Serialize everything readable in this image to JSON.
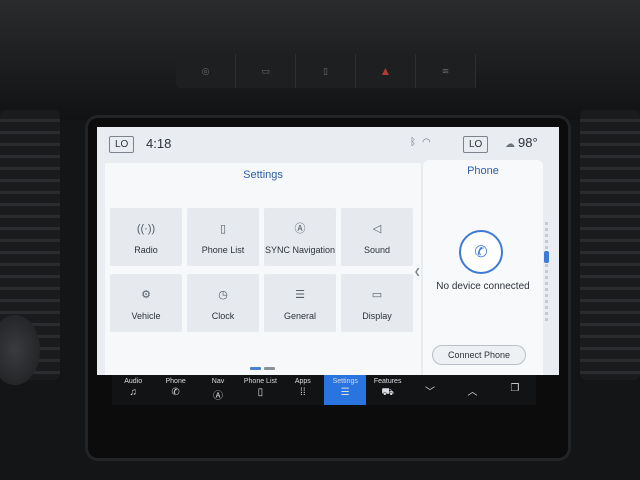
{
  "status": {
    "left_badge": "LO",
    "time": "4:18",
    "right_badge": "LO",
    "temperature": "98°"
  },
  "settings": {
    "title": "Settings",
    "tiles": [
      {
        "label": "Radio",
        "icon": "radio-icon",
        "glyph": "((·))"
      },
      {
        "label": "Phone List",
        "icon": "phone-list-icon",
        "glyph": "▯"
      },
      {
        "label": "SYNC Navigation",
        "icon": "navigation-icon",
        "glyph": "Ⓐ"
      },
      {
        "label": "Sound",
        "icon": "speaker-icon",
        "glyph": "◁"
      },
      {
        "label": "Vehicle",
        "icon": "vehicle-icon",
        "glyph": "⚙"
      },
      {
        "label": "Clock",
        "icon": "clock-icon",
        "glyph": "◷"
      },
      {
        "label": "General",
        "icon": "sliders-icon",
        "glyph": "☰"
      },
      {
        "label": "Display",
        "icon": "display-icon",
        "glyph": "▭"
      }
    ]
  },
  "phone": {
    "title": "Phone",
    "status": "No device connected",
    "connect_label": "Connect Phone"
  },
  "nav": [
    {
      "label": "Audio",
      "icon": "music-note-icon",
      "glyph": "♫",
      "active": false
    },
    {
      "label": "Phone",
      "icon": "phone-icon",
      "glyph": "✆",
      "active": false
    },
    {
      "label": "Nav",
      "icon": "navigation-icon",
      "glyph": "Ⓐ",
      "active": false
    },
    {
      "label": "Phone List",
      "icon": "phone-list-icon",
      "glyph": "▯",
      "active": false
    },
    {
      "label": "Apps",
      "icon": "apps-grid-icon",
      "glyph": "⁞⁞",
      "active": false
    },
    {
      "label": "Settings",
      "icon": "sliders-icon",
      "glyph": "☰",
      "active": true
    },
    {
      "label": "Features",
      "icon": "car-features-icon",
      "glyph": "⛟",
      "active": false
    }
  ],
  "nav_arrows": {
    "down": "﹀",
    "up": "︿",
    "copy": "❐"
  },
  "colors": {
    "accent": "#2a74df",
    "title_blue": "#2c5fa8",
    "screen_bg": "#e9edf2"
  }
}
